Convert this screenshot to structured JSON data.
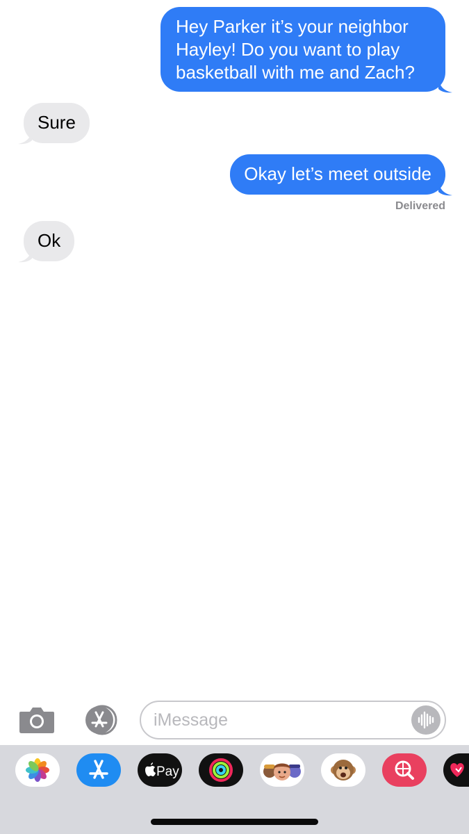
{
  "messages": [
    {
      "direction": "outgoing",
      "lines": [
        "Hey Parker it’s your neighbor",
        "Hayley! Do you want to play",
        "basketball with me and Zach?"
      ]
    },
    {
      "direction": "incoming",
      "text": "Sure"
    },
    {
      "direction": "outgoing",
      "text": "Okay let’s meet outside"
    },
    {
      "direction": "incoming",
      "text": "Ok"
    }
  ],
  "status": {
    "delivered": "Delivered"
  },
  "compose": {
    "placeholder": "iMessage",
    "value": ""
  },
  "apps": [
    {
      "name": "photos",
      "icon": "photos-icon"
    },
    {
      "name": "app-store",
      "icon": "app-store-icon"
    },
    {
      "name": "apple-pay",
      "icon": "apple-pay-icon",
      "label": "Pay"
    },
    {
      "name": "activity",
      "icon": "activity-rings-icon"
    },
    {
      "name": "memoji",
      "icon": "memoji-icon"
    },
    {
      "name": "animoji",
      "icon": "monkey-icon"
    },
    {
      "name": "web-search",
      "icon": "globe-search-icon"
    },
    {
      "name": "digital-touch",
      "icon": "heart-icon"
    }
  ],
  "colors": {
    "outgoing_bubble": "#2f7cf6",
    "incoming_bubble": "#e9e9eb",
    "drawer_background": "#d7d8dd"
  }
}
